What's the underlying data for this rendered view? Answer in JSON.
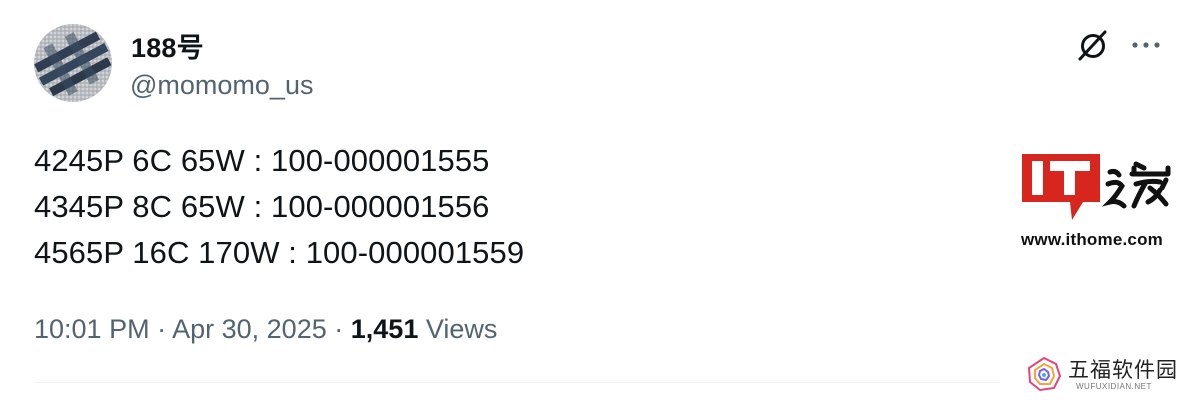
{
  "user": {
    "display_name": "188号",
    "handle": "@momomo_us"
  },
  "tweet": {
    "lines": [
      "4245P 6C 65W : 100-000001555",
      "4345P 8C 65W : 100-000001556",
      "4565P 16C 170W : 100-000001559"
    ]
  },
  "meta": {
    "time": "10:01 PM",
    "separator": "·",
    "date": "Apr 30, 2025",
    "views_count": "1,451",
    "views_label": "Views"
  },
  "actions": {
    "grok_icon": "grok-slash-circle-icon",
    "more_icon": "more-dots-icon"
  },
  "watermarks": {
    "ithome_logo": "IT之家",
    "ithome_url": "www.ithome.com",
    "wufu_name": "五福软件园",
    "wufu_domain": "WUFUXIDIAN.NET"
  },
  "colors": {
    "text_primary": "#0f1419",
    "text_secondary": "#536471",
    "ithome_red": "#d7261e"
  }
}
